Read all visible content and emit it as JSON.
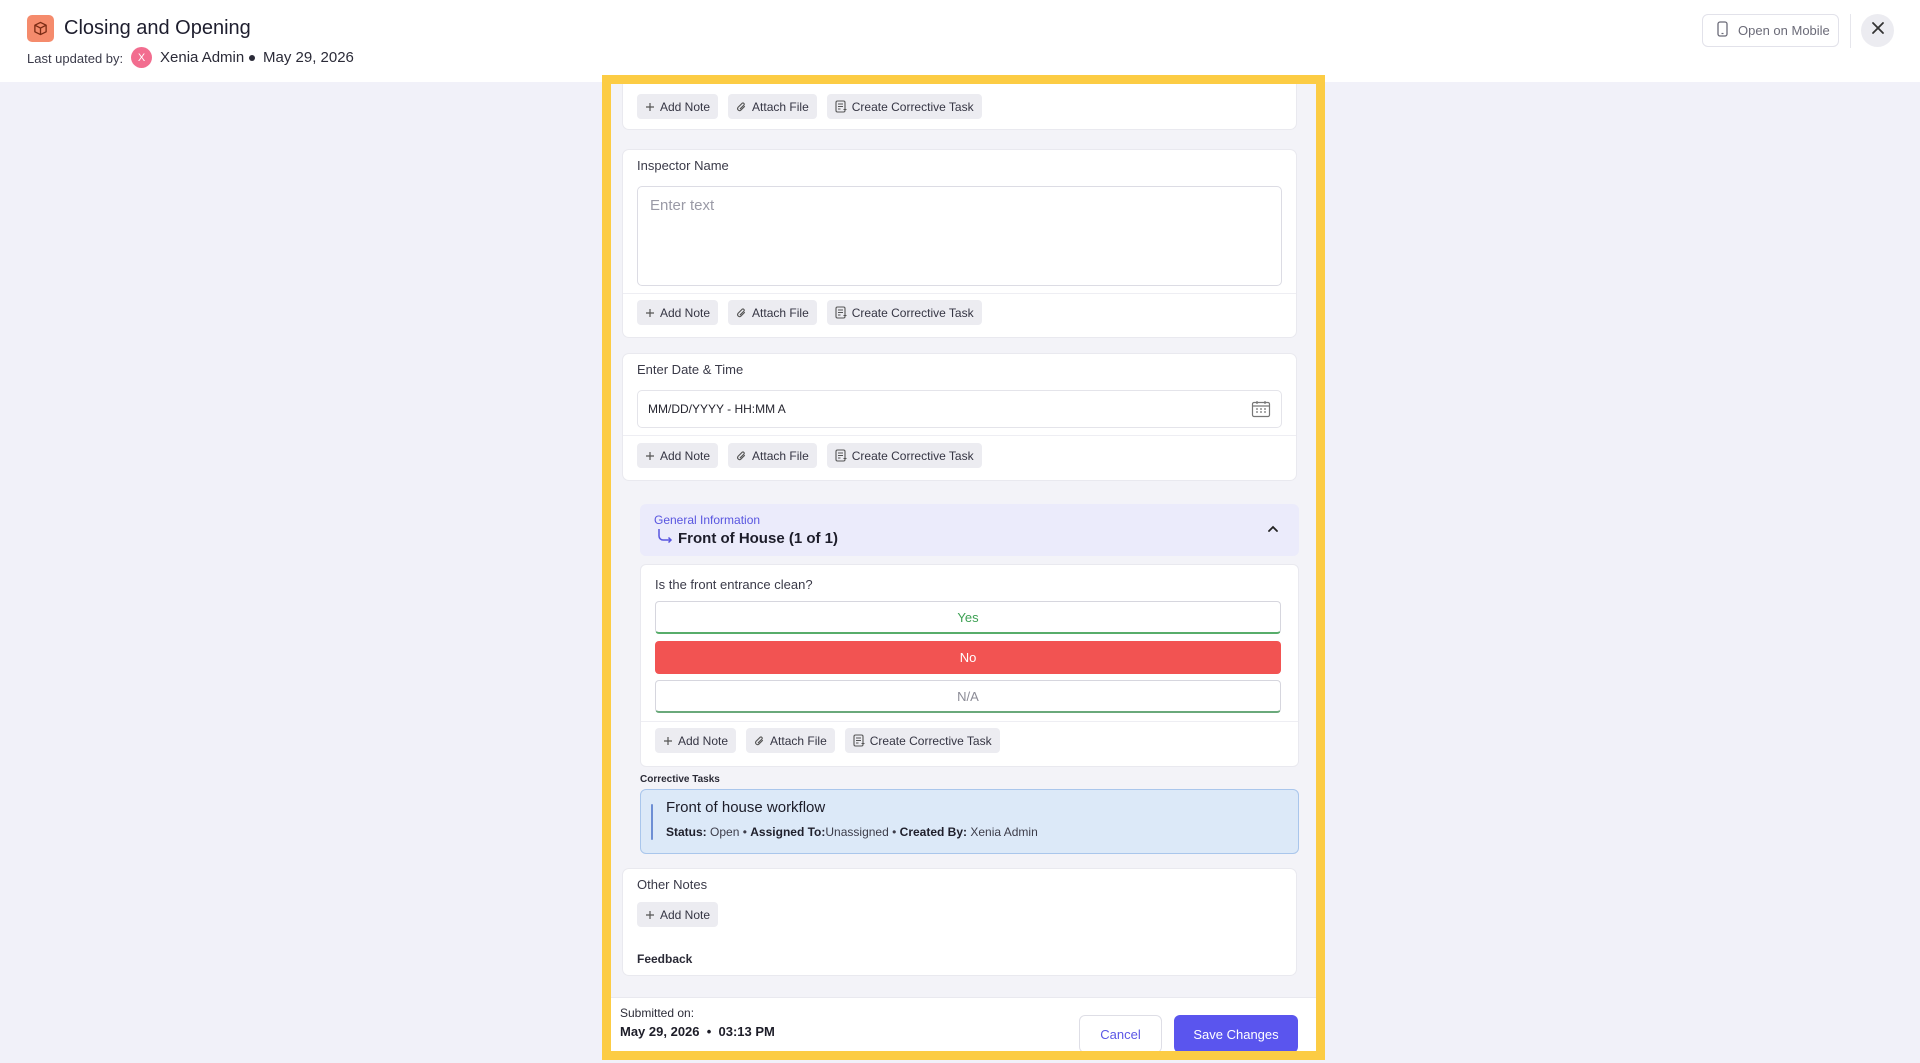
{
  "header": {
    "title": "Closing and Opening",
    "last_updated_label": "Last updated by:",
    "avatar_initial": "X",
    "user": "Xenia Admin",
    "date": "May 29, 2026",
    "open_mobile_label": "Open on Mobile",
    "icons": {
      "app": "box-icon",
      "mobile": "mobile-phone-icon",
      "close": "close-icon"
    }
  },
  "actions": {
    "add_note": "Add Note",
    "attach_file": "Attach File",
    "create_task": "Create Corrective Task"
  },
  "fields": {
    "inspector_name": {
      "label": "Inspector Name",
      "placeholder": "Enter text"
    },
    "date_time": {
      "label": "Enter Date & Time",
      "placeholder": "MM/DD/YYYY - HH:MM A"
    }
  },
  "section": {
    "label": "General Information",
    "title": "Front of House (1 of 1)"
  },
  "question": {
    "label": "Is the front entrance clean?",
    "options": [
      "Yes",
      "No",
      "N/A"
    ],
    "selected": "No"
  },
  "corrective_tasks": {
    "label": "Corrective Tasks",
    "task": {
      "title": "Front of house workflow",
      "status_label": "Status:",
      "status": "Open",
      "assigned_label": "Assigned To:",
      "assigned": "Unassigned",
      "created_label": "Created By:",
      "created": "Xenia Admin",
      "separator": "•"
    }
  },
  "other_notes": {
    "label": "Other Notes",
    "feedback_label": "Feedback"
  },
  "footer": {
    "submitted_label": "Submitted on:",
    "submitted_value": "May 29, 2026  •  03:13 PM",
    "cancel": "Cancel",
    "save": "Save Changes"
  },
  "colors": {
    "accent": "#5a55ee",
    "highlight_border": "#fccc44",
    "no_selected": "#f25352",
    "yes_text": "#3ea154",
    "task_card": "#dce9f8"
  }
}
